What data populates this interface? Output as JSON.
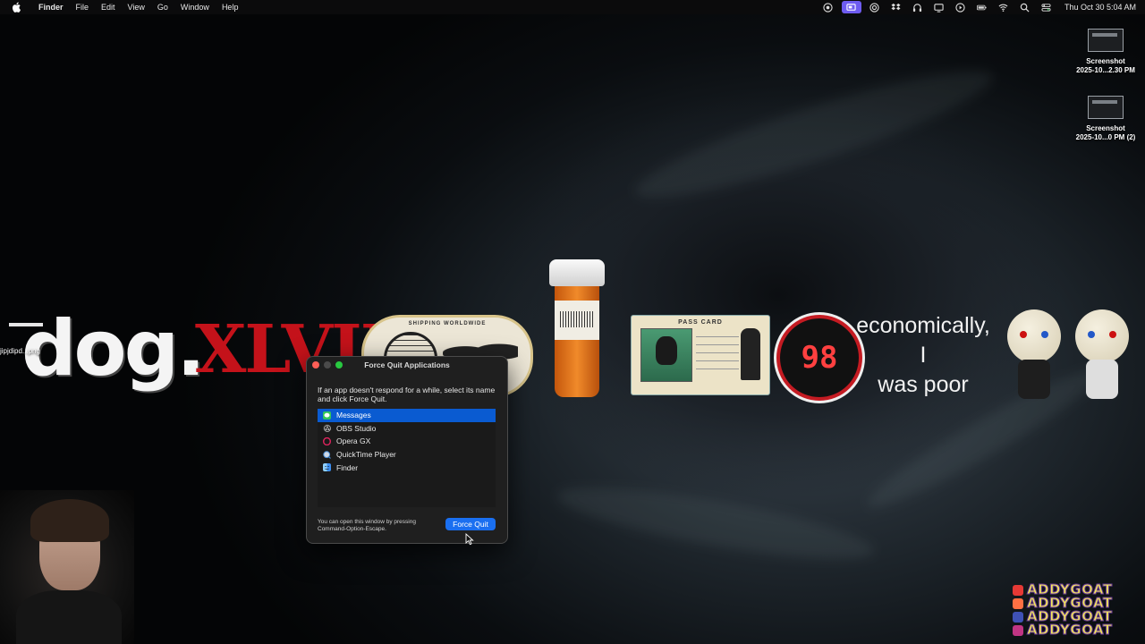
{
  "menubar": {
    "app_name": "Finder",
    "menus": [
      "File",
      "Edit",
      "View",
      "Go",
      "Window",
      "Help"
    ],
    "clock": "Thu Oct 30  5:04 AM"
  },
  "desktop_icons": [
    {
      "line1": "Screenshot",
      "line2": "2025-10...2.30 PM"
    },
    {
      "line1": "Screenshot",
      "line2": "2025-10...0 PM (2)"
    }
  ],
  "overlay": {
    "dog": "dog.",
    "xlvii": "XLVII",
    "file_label": "jipjdipd...png",
    "stamp_text": "SHIPPING WORLDWIDE",
    "pass_card_title": "PASS CARD",
    "badge_number": "98",
    "quote": [
      "economically,",
      "I",
      "was poor"
    ]
  },
  "social": {
    "handle": "ADDYGOAT",
    "icon_colors": [
      "#e53935",
      "#ff7043",
      "#3f51b5",
      "#c13584"
    ]
  },
  "force_quit": {
    "title": "Force Quit Applications",
    "description": "If an app doesn't respond for a while, select its name and click Force Quit.",
    "apps": [
      {
        "name": "Messages",
        "icon": "messages-icon",
        "color": "#34c759",
        "selected": true
      },
      {
        "name": "OBS Studio",
        "icon": "obs-icon",
        "color": "#3a3a3a",
        "selected": false
      },
      {
        "name": "Opera GX",
        "icon": "opera-gx-icon",
        "color": "#e0245e",
        "selected": false
      },
      {
        "name": "QuickTime Player",
        "icon": "quicktime-icon",
        "color": "#4a90d9",
        "selected": false
      },
      {
        "name": "Finder",
        "icon": "finder-icon",
        "color": "#3d8ef0",
        "selected": false
      }
    ],
    "footnote": "You can open this window by pressing Command-Option-Escape.",
    "button_label": "Force Quit"
  },
  "colors": {
    "selection": "#0a5bd1",
    "button": "#1a6ff0",
    "active_status": "#6e5cf0"
  }
}
